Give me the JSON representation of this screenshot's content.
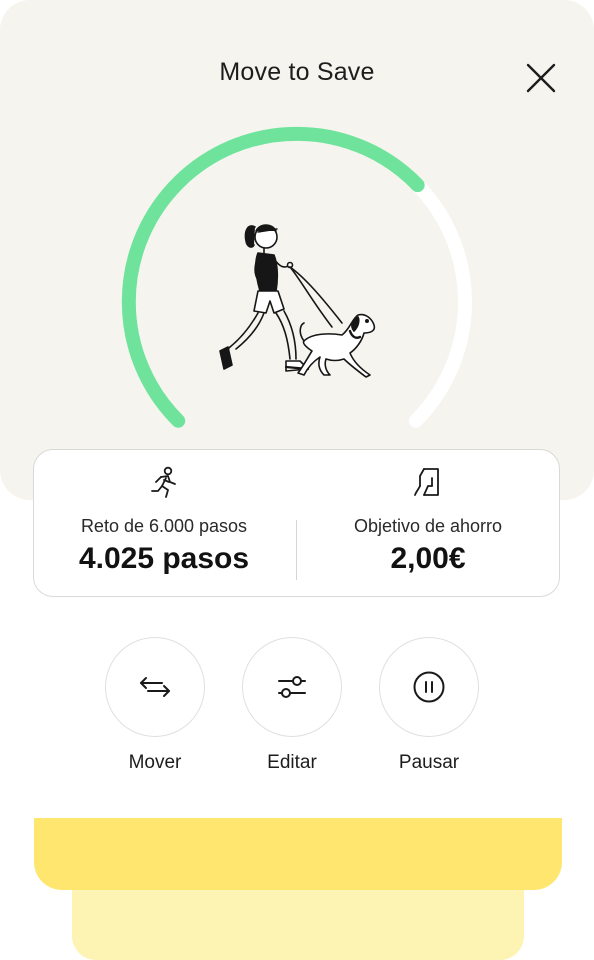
{
  "header": {
    "title": "Move to Save"
  },
  "progress": {
    "steps_done": 4025,
    "steps_goal": 6000,
    "fraction": 0.67
  },
  "colors": {
    "progress": "#6fe39c",
    "track": "#ffffff",
    "hero_bg": "#f6f4ee",
    "card_yellow": "#ffe76f",
    "card_yellow_light": "#fdf3b2"
  },
  "stats": {
    "steps": {
      "icon": "running-person-icon",
      "label": "Reto de 6.000 pasos",
      "value": "4.025 pasos"
    },
    "savings": {
      "icon": "savings-goal-icon",
      "label": "Objetivo de ahorro",
      "value": "2,00€"
    }
  },
  "actions": [
    {
      "icon": "transfer-arrows-icon",
      "label": "Mover"
    },
    {
      "icon": "sliders-icon",
      "label": "Editar"
    },
    {
      "icon": "pause-icon",
      "label": "Pausar"
    }
  ]
}
